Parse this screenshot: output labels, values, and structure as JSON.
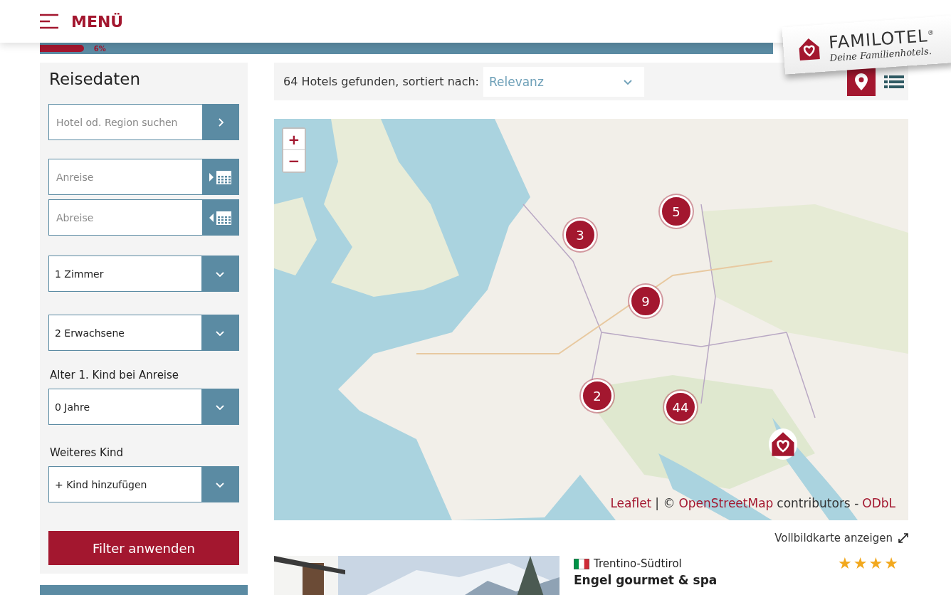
{
  "header": {
    "menu_label": "MENÜ",
    "logo": {
      "name": "FAMILOTEL",
      "registered": "®",
      "tagline": "Deine Familienhotels."
    }
  },
  "progress": {
    "level": 0.06,
    "reading": "6%"
  },
  "sidebar": {
    "title": "Reisedaten",
    "fields": [
      {
        "kind": "search",
        "placeholder": "Hotel od. Region suchen"
      },
      {
        "kind": "arrival",
        "placeholder": "Anreise"
      },
      {
        "kind": "departure",
        "placeholder": "Abreise"
      },
      {
        "kind": "select",
        "value": "1 Zimmer"
      },
      {
        "kind": "select",
        "value": "2 Erwachsene"
      },
      {
        "kind": "label",
        "text": "Alter 1. Kind bei Anreise"
      },
      {
        "kind": "select",
        "value": "0 Jahre"
      },
      {
        "kind": "label",
        "text": "Weiteres Kind"
      },
      {
        "kind": "select",
        "value": "+ Kind hinzufügen"
      }
    ],
    "apply_button": "Filter anwenden"
  },
  "results": {
    "summary": "64 Hotels gefunden, sortiert nach:",
    "sort": "Relevanz",
    "views": [
      {
        "kind": "map",
        "selected": true
      },
      {
        "kind": "list",
        "selected": false
      }
    ]
  },
  "map": {
    "zoom_in": "+",
    "zoom_out": "−",
    "clusters": [
      {
        "count": "3"
      },
      {
        "count": "5"
      },
      {
        "count": "9"
      },
      {
        "count": "2"
      },
      {
        "count": "44"
      }
    ],
    "attribution": {
      "leaflet": "Leaflet",
      "sep": "| ©",
      "osm": "OpenStreetMap",
      "contrib": "contributors -",
      "license": "ODbL"
    },
    "fullscreen": "Vollbildkarte anzeigen"
  },
  "hotel": {
    "region": "Trentino-Südtirol",
    "stars": 4,
    "name": "Engel gourmet & spa"
  }
}
